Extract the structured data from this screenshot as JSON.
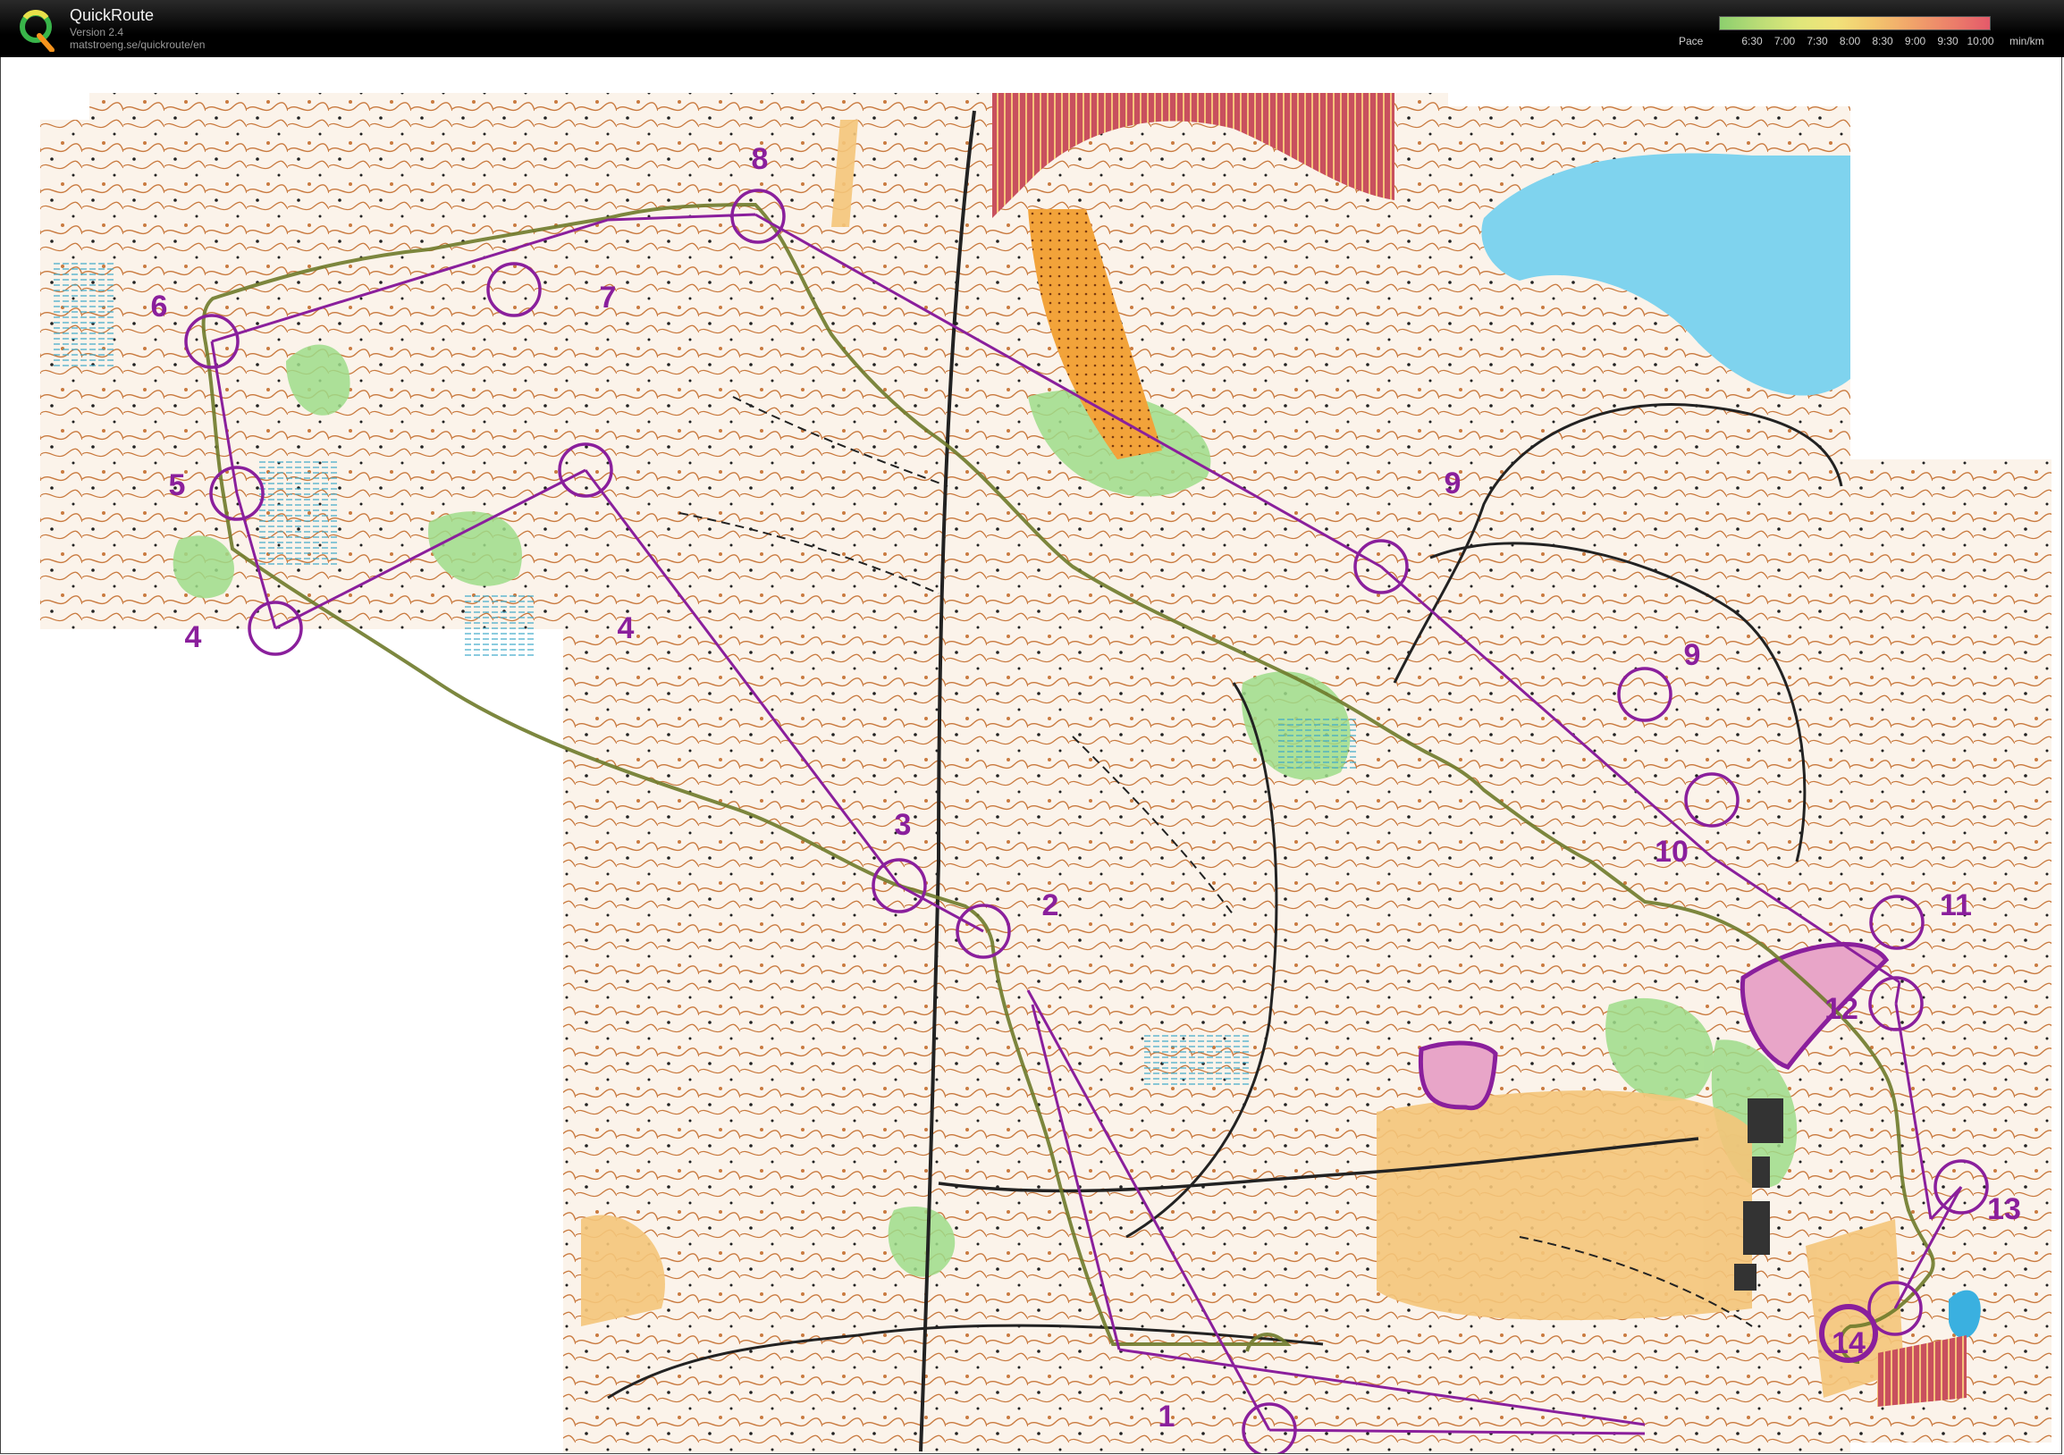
{
  "app": {
    "title": "QuickRoute",
    "version": "Version 2.4",
    "url": "matstroeng.se/quickroute/en"
  },
  "pace_legend": {
    "label": "Pace",
    "unit": "min/km",
    "ticks": [
      "6:30",
      "7:00",
      "7:30",
      "8:00",
      "8:30",
      "9:00",
      "9:30",
      "10:00"
    ],
    "colors": [
      "#8ccf6e",
      "#b9dc76",
      "#dfe77a",
      "#f1e27a",
      "#f3c66e",
      "#f1a46a",
      "#ec7f6a",
      "#e45a6a"
    ]
  },
  "map": {
    "course_color": "#8a1f9c",
    "route_color": "#6e7a2a",
    "controls": [
      {
        "label": "1"
      },
      {
        "label": "2"
      },
      {
        "label": "3"
      },
      {
        "label": "4"
      },
      {
        "label": "4"
      },
      {
        "label": "5"
      },
      {
        "label": "6"
      },
      {
        "label": "7"
      },
      {
        "label": "8"
      },
      {
        "label": "9"
      },
      {
        "label": "9"
      },
      {
        "label": "10"
      },
      {
        "label": "11"
      },
      {
        "label": "12"
      },
      {
        "label": "13"
      },
      {
        "label": "14"
      }
    ]
  }
}
